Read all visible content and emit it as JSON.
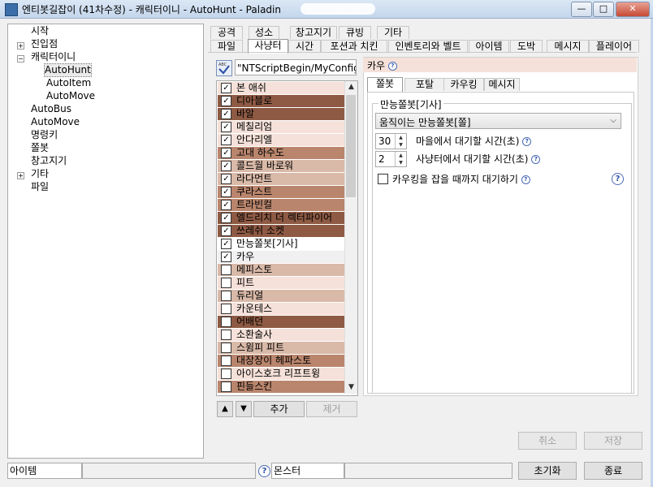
{
  "window": {
    "title": "엔티봇길잡이 (41차수정) - 캐릭터이니 - AutoHunt - Paladin",
    "minimize_glyph": "—",
    "maximize_glyph": "□",
    "close_glyph": "✕"
  },
  "tree": {
    "items": [
      {
        "label": "시작"
      },
      {
        "label": "진입점"
      },
      {
        "label": "캐릭터이니"
      },
      {
        "label": "AutoHunt"
      },
      {
        "label": "AutoItem"
      },
      {
        "label": "AutoMove"
      },
      {
        "label": "AutoBus"
      },
      {
        "label": "AutoMove"
      },
      {
        "label": "명령키"
      },
      {
        "label": "쫄봇"
      },
      {
        "label": "창고지기"
      },
      {
        "label": "기타"
      },
      {
        "label": "파일"
      }
    ],
    "expand_glyph": "+",
    "collapse_glyph": "−"
  },
  "tabs": {
    "top_row": [
      "공격",
      "성소",
      "창고지기",
      "큐빙",
      "기타"
    ],
    "bottom_row": [
      "파일",
      "사냥터",
      "시간",
      "포션과 치킨",
      "인벤토리와 벨트",
      "아이템",
      "도박",
      "메시지",
      "플레이어"
    ],
    "active": "사냥터"
  },
  "script_field": {
    "icon": "abc-check-icon",
    "value": "\"NTScriptBegin/MyConfig."
  },
  "monster_list": {
    "items": [
      {
        "label": "본 애쉬",
        "checked": true,
        "color": "#f5e1d9"
      },
      {
        "label": "디아블로",
        "checked": true,
        "color": "#8e5a44"
      },
      {
        "label": "바알",
        "checked": true,
        "color": "#8e5a44"
      },
      {
        "label": "메칠리엄",
        "checked": true,
        "color": "#f5e1d9"
      },
      {
        "label": "안다리엘",
        "checked": true,
        "color": "#f5e1d9"
      },
      {
        "label": "고대 하수도",
        "checked": true,
        "color": "#b9856d"
      },
      {
        "label": "콜드월 바로워",
        "checked": true,
        "color": "#d9b9a8"
      },
      {
        "label": "라다먼트",
        "checked": true,
        "color": "#d9b9a8"
      },
      {
        "label": "쿠라스트",
        "checked": true,
        "color": "#b9856d"
      },
      {
        "label": "트라빈컬",
        "checked": true,
        "color": "#b9856d"
      },
      {
        "label": "엘드리치 더 렉터파이어",
        "checked": true,
        "color": "#8e5a44"
      },
      {
        "label": "쓰레쉬 소켓",
        "checked": true,
        "color": "#8e5a44"
      },
      {
        "label": "만능쫄봇[기사]",
        "checked": true,
        "color": "#ffffff"
      },
      {
        "label": "카우",
        "checked": true,
        "color": "#f0f0f0"
      },
      {
        "label": "메피스토",
        "checked": false,
        "color": "#d9b9a8"
      },
      {
        "label": "피트",
        "checked": false,
        "color": "#f5e1d9"
      },
      {
        "label": "듀리얼",
        "checked": false,
        "color": "#d9b9a8"
      },
      {
        "label": "카운테스",
        "checked": false,
        "color": "#f5e1d9"
      },
      {
        "label": "어배던",
        "checked": false,
        "color": "#8e5a44"
      },
      {
        "label": "소환술사",
        "checked": false,
        "color": "#f5e1d9"
      },
      {
        "label": "스윔피 피트",
        "checked": false,
        "color": "#d9b9a8"
      },
      {
        "label": "대장장이 헤파스토",
        "checked": false,
        "color": "#b9856d"
      },
      {
        "label": "아이스호크 리프트윙",
        "checked": false,
        "color": "#f5e1d9"
      },
      {
        "label": "핀들스킨",
        "checked": false,
        "color": "#b9856d"
      }
    ],
    "check_glyph": "✓",
    "scroll_up_glyph": "▲",
    "scroll_down_glyph": "▼"
  },
  "list_buttons": {
    "up": "▲",
    "down": "▼",
    "add": "추가",
    "remove": "제거"
  },
  "detail": {
    "header": "카우",
    "help_glyph": "?",
    "inner_tabs": [
      "쫄봇",
      "포탈",
      "카우킹",
      "메시지"
    ],
    "active_inner_tab": "쫄봇",
    "group_title": "만능쫄봇[기사]",
    "mode_select": "움직이는 만능쫄봇[쫄]",
    "town_wait": {
      "value": "30",
      "label": "마을에서 대기할 시간(초)"
    },
    "field_wait": {
      "value": "2",
      "label": "사냥터에서 대기할 시간(초)"
    },
    "wait_cow_king": {
      "label": "카우킹을 잡을 때까지 대기하기",
      "checked": false
    }
  },
  "actions": {
    "cancel": "취소",
    "save": "저장"
  },
  "statusbar": {
    "item": "아이템",
    "monster": "몬스터",
    "reset": "초기화",
    "exit": "종료"
  }
}
